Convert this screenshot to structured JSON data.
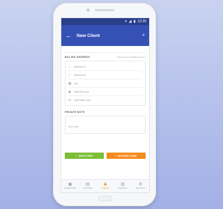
{
  "status": {
    "time": "12:30",
    "wifi_icon": "wifi-icon",
    "signal_icon": "signal-icon",
    "battery_icon": "battery-icon"
  },
  "appbar": {
    "title": "New Client",
    "back_icon": "arrow-left-icon",
    "search_icon": "search-icon"
  },
  "billing": {
    "title": "BILLING ADDRESS",
    "aux": "Address Same As Billing Address",
    "fields": [
      {
        "icon": "home-icon",
        "placeholder": "Address #1"
      },
      {
        "icon": "home-icon",
        "placeholder": "Address #2"
      },
      {
        "icon": "building-icon",
        "placeholder": "City"
      },
      {
        "icon": "map-pin-icon",
        "placeholder": "State/Province"
      },
      {
        "icon": "mail-icon",
        "placeholder": "Zip/Postal Code"
      }
    ]
  },
  "notes": {
    "title": "PRIVATE NOTE",
    "placeholder": "Add Notes"
  },
  "actions": {
    "save_label": "SAVE CLIENT",
    "add_label": "ADD NEW CLIENT"
  },
  "nav": [
    {
      "icon": "dashboard-icon",
      "label": "DASHBOARD",
      "active": false
    },
    {
      "icon": "invoice-icon",
      "label": "INVOICES",
      "active": false
    },
    {
      "icon": "user-icon",
      "label": "CLIENTS",
      "active": true
    },
    {
      "icon": "chart-icon",
      "label": "REPORTS",
      "active": false
    },
    {
      "icon": "gear-icon",
      "label": "SETTINGS",
      "active": false
    }
  ],
  "colors": {
    "appbar": "#3551b5",
    "statusbar": "#2a3f8a",
    "save": "#7cbe34",
    "add": "#f58a1f",
    "active_nav": "#f58a1f"
  }
}
